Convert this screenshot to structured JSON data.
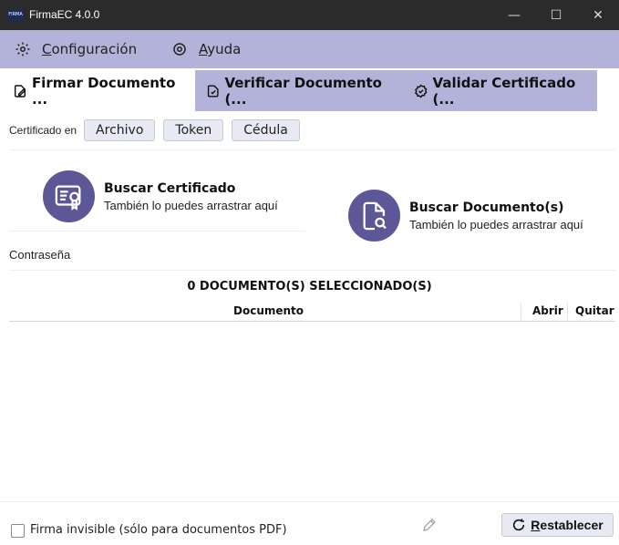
{
  "window": {
    "title": "FirmaEC 4.0.0",
    "icon_text": "FIRMA",
    "minimize": "—",
    "maximize": "☐",
    "close": "✕"
  },
  "menu": {
    "config_first": "C",
    "config_rest": "onfiguración",
    "help_first": "A",
    "help_rest": "yuda"
  },
  "tabs": [
    {
      "label": "Firmar Documento ...",
      "active": true
    },
    {
      "label": "Verificar Documento (...",
      "active": false
    },
    {
      "label": "Validar Certificado (...",
      "active": false
    }
  ],
  "certificate": {
    "label": "Certificado en",
    "options": [
      "Archivo",
      "Token",
      "Cédula"
    ]
  },
  "cert_picker": {
    "title": "Buscar Certificado",
    "hint": "También lo puedes arrastrar aquí"
  },
  "doc_picker": {
    "title": "Buscar Documento(s)",
    "hint": "También lo puedes arrastrar aquí"
  },
  "password_label": "Contraseña",
  "documents": {
    "count_title": "0 DOCUMENTO(S) SELECCIONADO(S)",
    "columns": [
      "Documento",
      "Abrir",
      "Quitar"
    ]
  },
  "footer": {
    "invisible_signature": "Firma invisible (sólo para documentos PDF)",
    "reset_first": "R",
    "reset_rest": "establecer"
  },
  "colors": {
    "accent": "#5c5796",
    "menu_bg": "#b3b3d9",
    "titlebar_bg": "#2b2b2b"
  }
}
